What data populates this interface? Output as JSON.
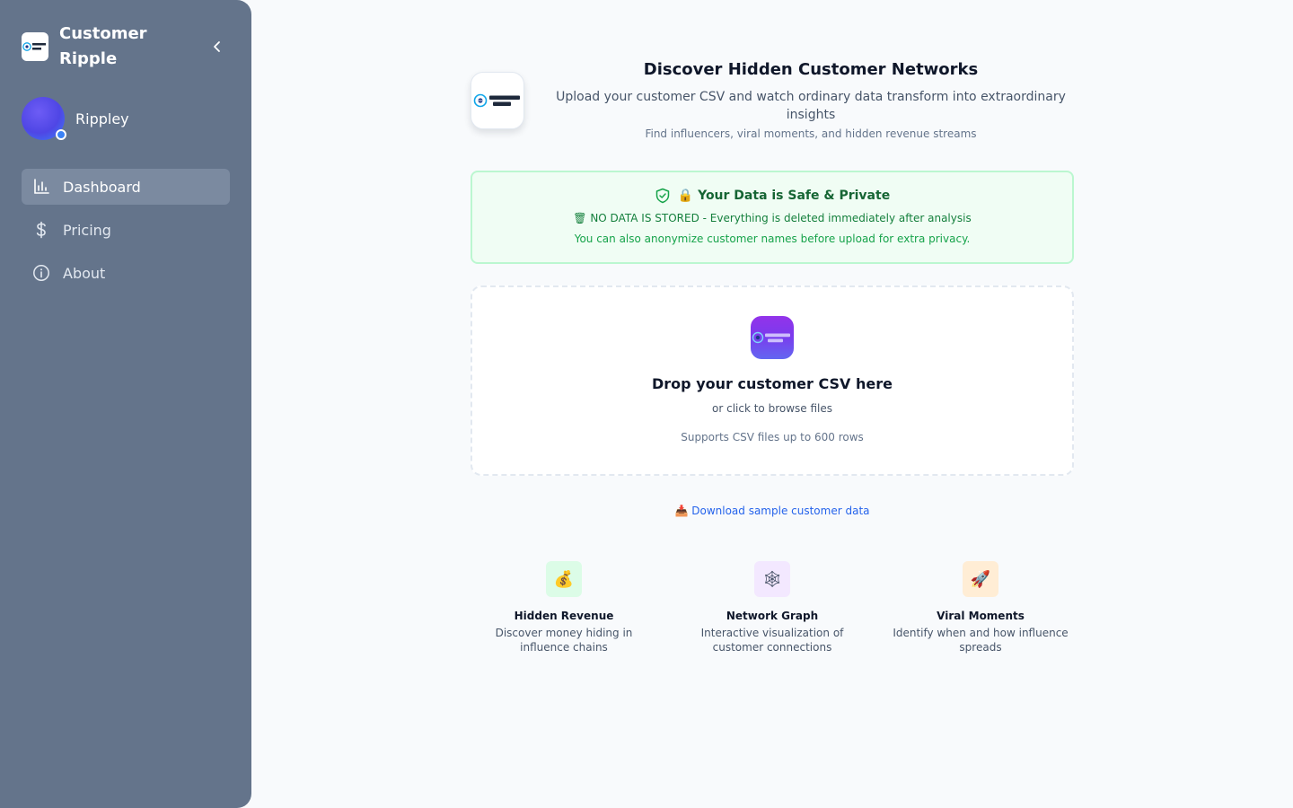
{
  "sidebar": {
    "brand": {
      "title": "Customer Ripple",
      "logo_text_top": "Customer",
      "logo_text_bottom": "Ripple"
    },
    "user": {
      "name": "Rippley"
    },
    "nav": [
      {
        "label": "Dashboard",
        "icon": "bar-chart-icon",
        "active": true
      },
      {
        "label": "Pricing",
        "icon": "dollar-icon",
        "active": false
      },
      {
        "label": "About",
        "icon": "info-icon",
        "active": false
      }
    ]
  },
  "hero": {
    "title": "Discover Hidden Customer Networks",
    "subtitle": "Upload your customer CSV and watch ordinary data transform into extraordinary insights",
    "tagline": "Find influencers, viral moments, and hidden revenue streams"
  },
  "privacy": {
    "title": "🔒 Your Data is Safe & Private",
    "line1": "🗑 NO DATA IS STORED - Everything is deleted immediately after analysis",
    "line2": "You can also anonymize customer names before upload for extra privacy."
  },
  "upload": {
    "title": "Drop your customer CSV here",
    "subtitle": "or click to browse files",
    "note": "Supports CSV files up to 600 rows"
  },
  "sample": {
    "label": "📥 Download sample customer data"
  },
  "features": [
    {
      "icon_glyph": "💰",
      "title": "Hidden Revenue",
      "desc": "Discover money hiding in influence chains",
      "bg": "#dcfce7"
    },
    {
      "icon_glyph": "🕸",
      "title": "Network Graph",
      "desc": "Interactive visualization of customer connections",
      "bg": "#f3e8ff"
    },
    {
      "icon_glyph": "🚀",
      "title": "Viral Moments",
      "desc": "Identify when and how influence spreads",
      "bg": "#ffedd5"
    }
  ],
  "colors": {
    "sidebar_bg": "#64748b",
    "accent": "#2563eb",
    "safe_green": "#166534"
  }
}
